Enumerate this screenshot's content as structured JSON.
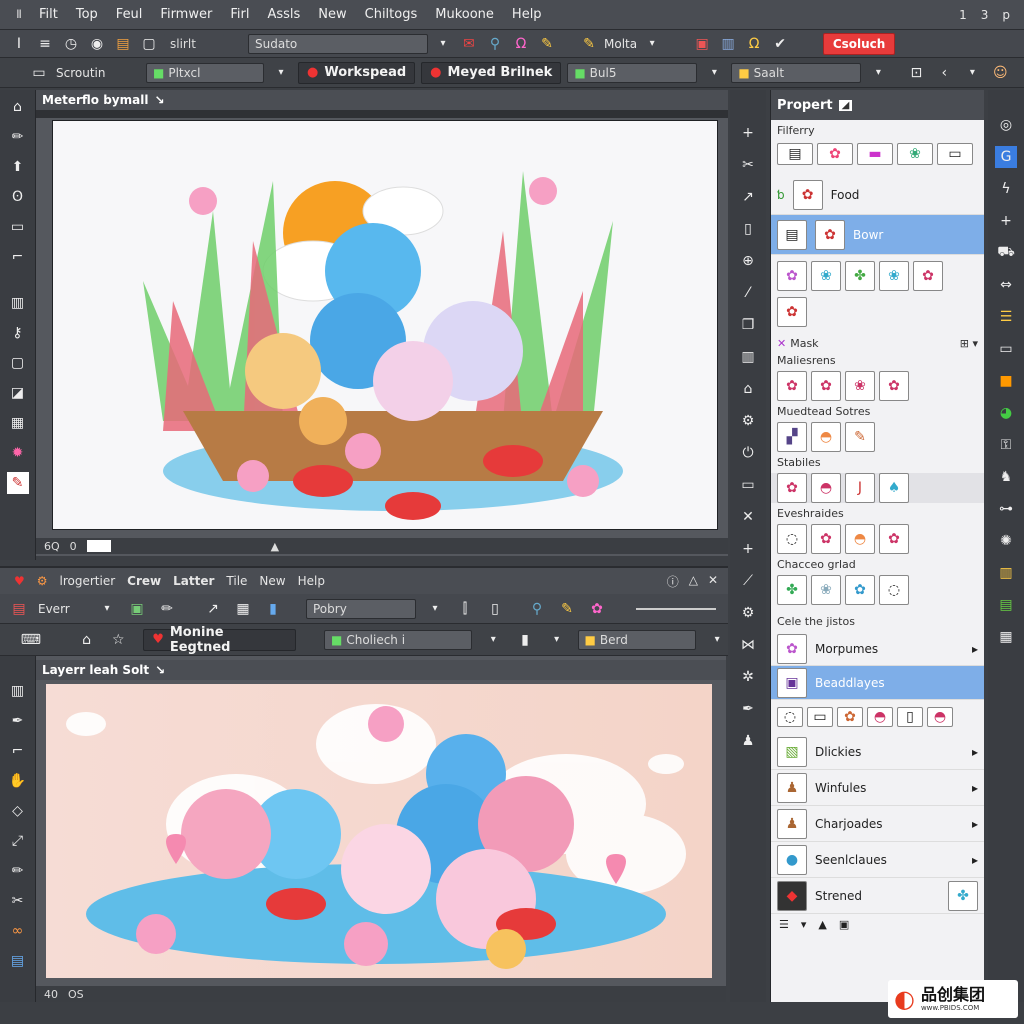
{
  "menubar": {
    "items": [
      "Filt",
      "Top",
      "Feul",
      "Firmwer",
      "Firl",
      "Assls",
      "New",
      "Chiltogs",
      "Mukoone",
      "Help"
    ],
    "right": [
      "1",
      "3",
      "p"
    ]
  },
  "toolbar1": {
    "field1": "slirlt",
    "field2": "Sudato",
    "mode": "Molta",
    "action_button": "Csoluch"
  },
  "toolbar2": {
    "item1": "Scroutin",
    "field1": "Pltxcl",
    "chip1": "Workspead",
    "chip2": "Meyed Brilnek",
    "field2": "Bul5",
    "field3": "Saalt"
  },
  "doc1": {
    "tab": "Meterflo bymall",
    "status": [
      "6Q",
      "0"
    ]
  },
  "panel2": {
    "menu": [
      "lrogertier",
      "Crew",
      "Latter",
      "Tile",
      "New",
      "Help"
    ],
    "toolbar_select": "Everr",
    "toolbar_field": "Pobry",
    "chip": "Monine Eegtned",
    "field1": "Choliech i",
    "field2": "Berd"
  },
  "doc2": {
    "tab": "Layerr leah Solt",
    "status": [
      "40",
      "OS"
    ]
  },
  "properties": {
    "title": "Propert",
    "filter_label": "Filferry",
    "rows": [
      {
        "label": "Food",
        "selected": false
      },
      {
        "label": "Bowr",
        "selected": true
      }
    ],
    "mask_label": "Mask",
    "sections": [
      "Maliesrens",
      "Muedtead Sotres",
      "Stabiles",
      "Eveshraides",
      "Chacceo grlad"
    ],
    "list_heading": "Cele the jistos",
    "list": [
      {
        "label": "Morpumes",
        "selected": false
      },
      {
        "label": "Beaddlayes",
        "selected": true
      },
      {
        "label": "Dlickies",
        "selected": false
      },
      {
        "label": "Winfules",
        "selected": false
      },
      {
        "label": "Charjoades",
        "selected": false
      },
      {
        "label": "Seenlclaues",
        "selected": false
      },
      {
        "label": "Strened",
        "selected": false
      }
    ]
  },
  "watermark": {
    "text": "品创集团",
    "sub": "www.PBIDS.COM"
  },
  "colors": {
    "accent": "#e83b3b",
    "selection": "#7eaee8",
    "chrome": "#3c3f44"
  }
}
